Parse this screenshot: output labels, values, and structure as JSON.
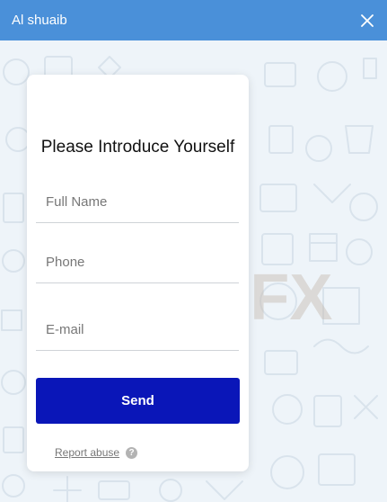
{
  "header": {
    "title": "Al shuaib",
    "close_icon": "close-icon",
    "accent_color": "#4a90d9"
  },
  "form": {
    "title": "Please Introduce Yourself",
    "fields": {
      "full_name": {
        "placeholder": "Full Name",
        "value": ""
      },
      "phone": {
        "placeholder": "Phone",
        "value": ""
      },
      "email": {
        "placeholder": "E-mail",
        "value": ""
      }
    },
    "send_label": "Send",
    "send_color": "#0a16b8",
    "report_label": "Report abuse",
    "help_icon": "question-circle-icon",
    "help_glyph": "?"
  },
  "watermark": {
    "text": "WikiFX"
  }
}
